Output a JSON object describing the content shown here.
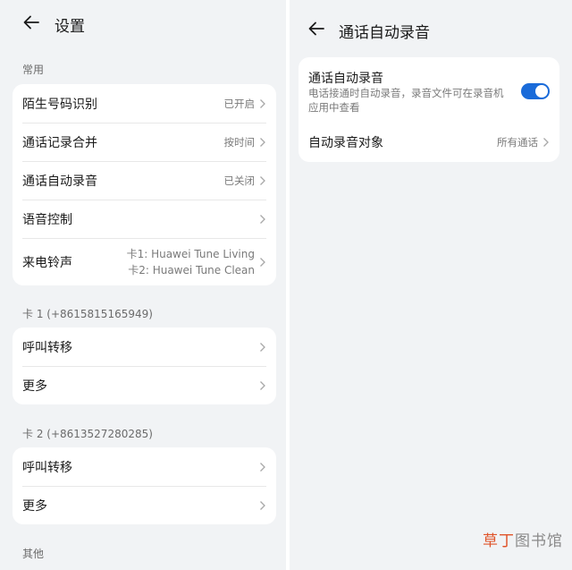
{
  "left": {
    "header": {
      "title": "设置"
    },
    "sections": [
      {
        "label": "常用",
        "items": [
          {
            "label": "陌生号码识别",
            "value": "已开启"
          },
          {
            "label": "通话记录合并",
            "value": "按时间"
          },
          {
            "label": "通话自动录音",
            "value": "已关闭"
          },
          {
            "label": "语音控制",
            "value": ""
          },
          {
            "label": "来电铃声",
            "value_lines": [
              "卡1: Huawei Tune Living",
              "卡2: Huawei Tune Clean"
            ]
          }
        ]
      },
      {
        "label": "卡 1 (+8615815165949)",
        "items": [
          {
            "label": "呼叫转移"
          },
          {
            "label": "更多"
          }
        ]
      },
      {
        "label": "卡 2 (+8613527280285)",
        "items": [
          {
            "label": "呼叫转移"
          },
          {
            "label": "更多"
          }
        ]
      },
      {
        "label": "其他"
      }
    ]
  },
  "right": {
    "header": {
      "title": "通话自动录音"
    },
    "toggle_item": {
      "title": "通话自动录音",
      "description": "电话接通时自动录音，录音文件可在录音机应用中查看",
      "enabled": true
    },
    "target_item": {
      "label": "自动录音对象",
      "value": "所有通话"
    }
  },
  "watermark": {
    "part1": "草丁",
    "part2": "图书馆"
  },
  "colors": {
    "background": "#f1f3f5",
    "card": "#ffffff",
    "accent": "#1a6bd9",
    "watermark_red": "#e0542a",
    "watermark_gray": "#8a8a8a"
  },
  "icons": {
    "back": "arrow-left-icon",
    "chevron": "chevron-right-icon"
  }
}
